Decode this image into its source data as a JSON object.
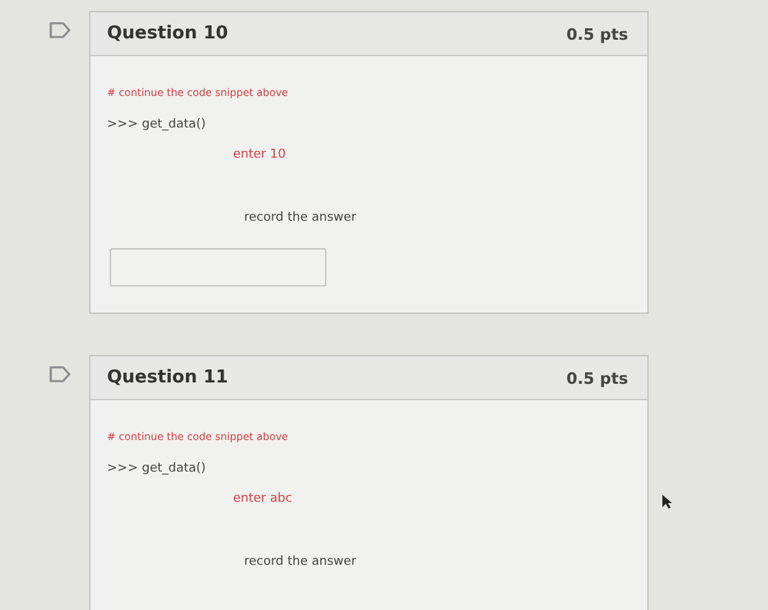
{
  "questions": [
    {
      "title": "Question 10",
      "points": "0.5 pts",
      "flagged": false,
      "lines": [
        {
          "kind": "comment",
          "text": "# continue the code snippet above"
        },
        {
          "kind": "code",
          "text": ">>> get_data()"
        },
        {
          "kind": "hint",
          "text": "enter 10"
        },
        {
          "kind": "instruction",
          "text": "record the answer"
        }
      ],
      "has_answer_field": true
    },
    {
      "title": "Question 11",
      "points": "0.5 pts",
      "flagged": false,
      "lines": [
        {
          "kind": "comment",
          "text": "# continue the code snippet above"
        },
        {
          "kind": "code",
          "text": ">>> get_data()"
        },
        {
          "kind": "hint",
          "text": "enter abc"
        },
        {
          "kind": "instruction",
          "text": "record the answer"
        }
      ],
      "has_answer_field": false
    }
  ]
}
